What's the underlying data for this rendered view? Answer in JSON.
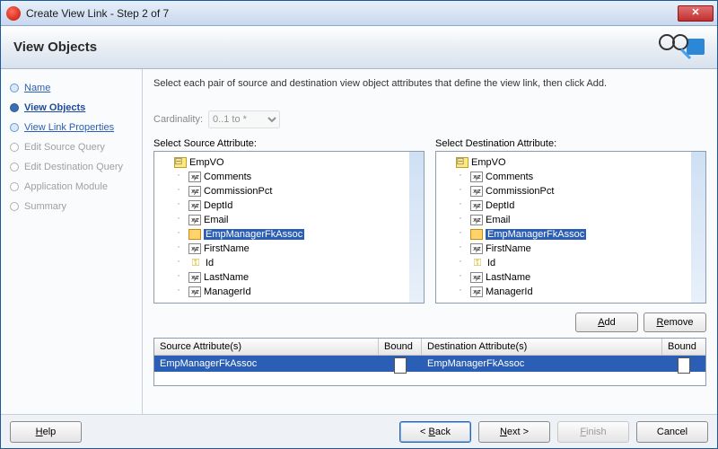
{
  "window": {
    "title": "Create View Link - Step 2 of 7"
  },
  "header": {
    "title": "View Objects"
  },
  "steps": [
    {
      "label": "Name",
      "state": "done"
    },
    {
      "label": "View Objects",
      "state": "current"
    },
    {
      "label": "View Link Properties",
      "state": "done"
    },
    {
      "label": "Edit Source Query",
      "state": "disabled"
    },
    {
      "label": "Edit Destination Query",
      "state": "disabled"
    },
    {
      "label": "Application Module",
      "state": "disabled"
    },
    {
      "label": "Summary",
      "state": "disabled"
    }
  ],
  "instruction": "Select each pair of source and destination view object attributes that define the view link, then click Add.",
  "cardinality": {
    "label": "Cardinality:",
    "value": "0..1 to *"
  },
  "source": {
    "label": "Select Source Attribute:",
    "root": "EmpVO",
    "items": [
      {
        "name": "Comments",
        "icon": "xyz"
      },
      {
        "name": "CommissionPct",
        "icon": "xyz"
      },
      {
        "name": "DeptId",
        "icon": "xyz"
      },
      {
        "name": "Email",
        "icon": "xyz"
      },
      {
        "name": "EmpManagerFkAssoc",
        "icon": "assoc",
        "selected": true
      },
      {
        "name": "FirstName",
        "icon": "xyz"
      },
      {
        "name": "Id",
        "icon": "key"
      },
      {
        "name": "LastName",
        "icon": "xyz"
      },
      {
        "name": "ManagerId",
        "icon": "xyz"
      }
    ]
  },
  "destination": {
    "label": "Select Destination Attribute:",
    "root": "EmpVO",
    "items": [
      {
        "name": "Comments",
        "icon": "xyz"
      },
      {
        "name": "CommissionPct",
        "icon": "xyz"
      },
      {
        "name": "DeptId",
        "icon": "xyz"
      },
      {
        "name": "Email",
        "icon": "xyz"
      },
      {
        "name": "EmpManagerFkAssoc",
        "icon": "assoc",
        "selected": true
      },
      {
        "name": "FirstName",
        "icon": "xyz"
      },
      {
        "name": "Id",
        "icon": "key"
      },
      {
        "name": "LastName",
        "icon": "xyz"
      },
      {
        "name": "ManagerId",
        "icon": "xyz"
      }
    ]
  },
  "buttons": {
    "add": "Add",
    "remove": "Remove"
  },
  "table": {
    "headers": {
      "src": "Source Attribute(s)",
      "bound1": "Bound",
      "dst": "Destination Attribute(s)",
      "bound2": "Bound"
    },
    "row": {
      "src": "EmpManagerFkAssoc",
      "dst": "EmpManagerFkAssoc"
    }
  },
  "footer": {
    "help": "Help",
    "back": "< Back",
    "next": "Next >",
    "finish": "Finish",
    "cancel": "Cancel"
  }
}
